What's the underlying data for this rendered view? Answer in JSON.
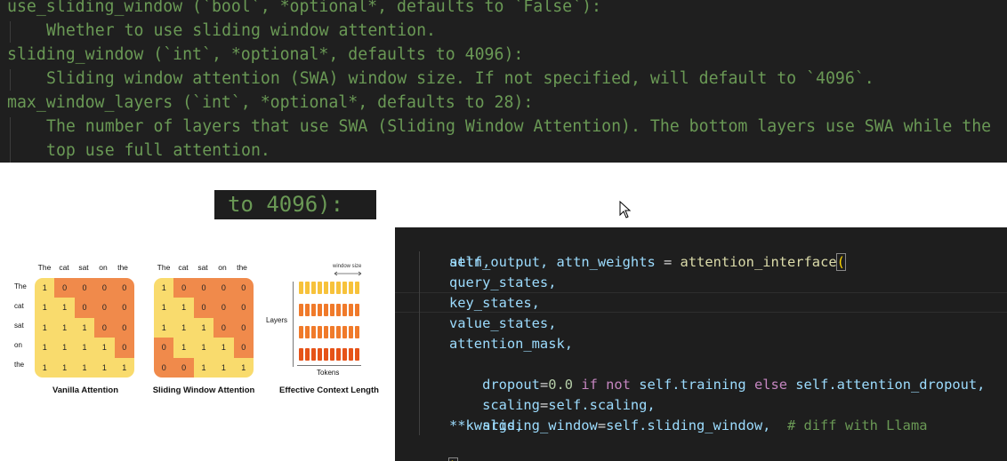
{
  "docstring": {
    "lines": [
      "use_sliding_window (`bool`, *optional*, defaults to `False`):",
      "Whether to use sliding window attention.",
      "sliding_window (`int`, *optional*, defaults to 4096):",
      "Sliding window attention (SWA) window size. If not specified, will default to `4096`.",
      "max_window_layers (`int`, *optional*, defaults to 28):",
      "The number of layers that use SWA (Sliding Window Attention). The bottom layers use SWA while the",
      "top use full attention."
    ]
  },
  "zoom_snippet": "to 4096):",
  "diagram": {
    "tokens": [
      "The",
      "cat",
      "sat",
      "on",
      "the"
    ],
    "vanilla": {
      "title": "Vanilla Attention",
      "matrix": [
        [
          1,
          0,
          0,
          0,
          0
        ],
        [
          1,
          1,
          0,
          0,
          0
        ],
        [
          1,
          1,
          1,
          0,
          0
        ],
        [
          1,
          1,
          1,
          1,
          0
        ],
        [
          1,
          1,
          1,
          1,
          1
        ]
      ]
    },
    "sliding": {
      "title": "Sliding Window Attention",
      "matrix": [
        [
          1,
          0,
          0,
          0,
          0
        ],
        [
          1,
          1,
          0,
          0,
          0
        ],
        [
          1,
          1,
          1,
          0,
          0
        ],
        [
          0,
          1,
          1,
          1,
          0
        ],
        [
          0,
          0,
          1,
          1,
          1
        ]
      ]
    },
    "context": {
      "title": "Effective Context Length",
      "window_label": "window size",
      "layers_label": "Layers",
      "tokens_label": "Tokens"
    },
    "colors": {
      "yellow": "#f9db6d",
      "orange": "#f08a4b"
    }
  },
  "code": {
    "line1": {
      "lhs": "attn_output, attn_weights",
      "eq": " = ",
      "fn": "attention_interface",
      "paren": "("
    },
    "args": [
      {
        "text": "self,"
      },
      {
        "text": "query_states,"
      },
      {
        "text": "key_states,"
      },
      {
        "text": "value_states,"
      },
      {
        "text": "attention_mask,"
      }
    ],
    "dropout": {
      "name": "dropout",
      "eq": "=",
      "num": "0.0",
      "if": " if ",
      "not": "not ",
      "mid": "self.training",
      "else": " else ",
      "tail": "self.attention_dropout,"
    },
    "scaling": {
      "name": "scaling",
      "eq": "=",
      "val": "self.scaling,"
    },
    "sliding": {
      "name": "sliding_window",
      "eq": "=",
      "val": "self.sliding_window,",
      "comment": "  # diff with Llama"
    },
    "kwargs": "**kwargs,",
    "close": ")"
  }
}
